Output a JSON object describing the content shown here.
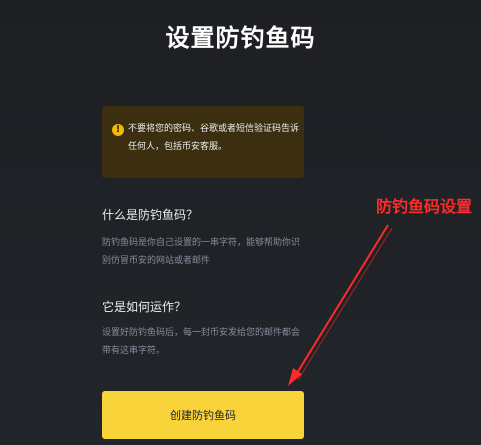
{
  "page": {
    "title": "设置防钓鱼码"
  },
  "warning": {
    "icon": "warning-icon",
    "glyph": "!",
    "text": "不要将您的密码、谷歌或者短信验证码告诉任何人，包括币安客服。"
  },
  "sections": [
    {
      "heading": "什么是防钓鱼码？",
      "body": "防钓鱼码是你自己设置的一串字符，能够帮助你识别仿冒币安的网站或者邮件"
    },
    {
      "heading": "它是如何运作？",
      "body": "设置好防钓鱼码后，每一封币安发给您的邮件都会带有这串字符。"
    }
  ],
  "annotation": {
    "label": "防钓鱼码设置",
    "color": "#ff2a2a"
  },
  "cta": {
    "label": "创建防钓鱼码",
    "color": "#f8d33a"
  }
}
